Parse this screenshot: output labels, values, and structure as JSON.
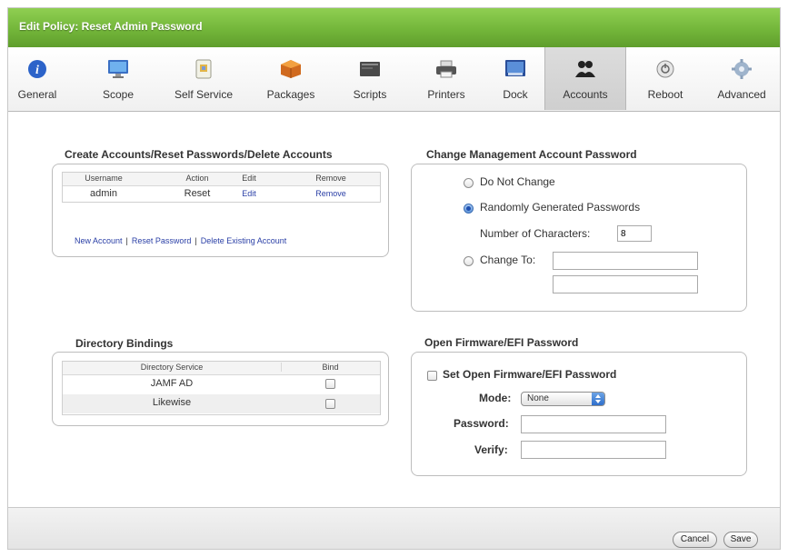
{
  "window": {
    "title": "Edit Policy: Reset Admin Password"
  },
  "tabs": [
    {
      "label": "General",
      "icon": "info-icon"
    },
    {
      "label": "Scope",
      "icon": "monitor-icon"
    },
    {
      "label": "Self Service",
      "icon": "self-service-icon"
    },
    {
      "label": "Packages",
      "icon": "package-icon"
    },
    {
      "label": "Scripts",
      "icon": "script-icon"
    },
    {
      "label": "Printers",
      "icon": "printer-icon"
    },
    {
      "label": "Dock",
      "icon": "dock-icon"
    },
    {
      "label": "Accounts",
      "icon": "users-icon",
      "active": true
    },
    {
      "label": "Reboot",
      "icon": "reboot-icon"
    },
    {
      "label": "Advanced",
      "icon": "gear-icon"
    }
  ],
  "accounts": {
    "title": "Create Accounts/Reset Passwords/Delete Accounts",
    "columns": [
      "Username",
      "Action",
      "Edit",
      "Remove"
    ],
    "rows": [
      {
        "username": "admin",
        "action": "Reset",
        "edit": "Edit",
        "remove": "Remove"
      }
    ],
    "links": [
      "New Account",
      "Reset Password",
      "Delete Existing Account"
    ]
  },
  "management": {
    "title": "Change Management Account Password",
    "option_no_change": "Do Not Change",
    "option_random": "Randomly Generated Passwords",
    "num_chars_label": "Number of Characters:",
    "num_chars_value": "8",
    "option_change_to": "Change To:",
    "selected": "random"
  },
  "directory": {
    "title": "Directory Bindings",
    "columns": [
      "Directory Service",
      "Bind"
    ],
    "rows": [
      {
        "service": "JAMF AD"
      },
      {
        "service": "Likewise"
      }
    ]
  },
  "firmware": {
    "title": "Open Firmware/EFI Password",
    "checkbox_label": "Set Open Firmware/EFI Password",
    "mode_label": "Mode:",
    "mode_value": "None",
    "password_label": "Password:",
    "verify_label": "Verify:"
  },
  "footer": {
    "cancel_label": "Cancel",
    "save_label": "Save"
  },
  "colors": {
    "titlebar": "#73b63a",
    "link": "#2a3fa6",
    "radio_selected": "#3e6fb4"
  }
}
